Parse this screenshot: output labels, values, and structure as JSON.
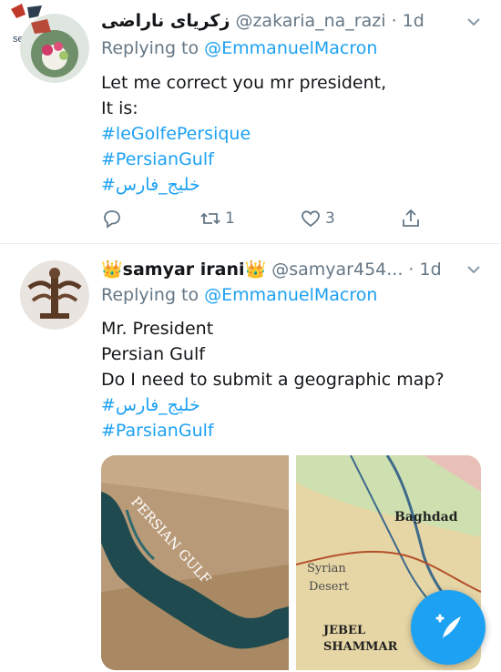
{
  "tweets": [
    {
      "name": "زکریای ناراضی",
      "handle": "@zakaria_na_razi",
      "dot": "·",
      "time": "1d",
      "replying_prefix": "Replying to ",
      "replying_to": "@EmmanuelMacron",
      "lines": [
        "Let me correct you mr president,",
        "It is:"
      ],
      "hashtags": [
        "#leGolfePersique",
        "#PersianGulf",
        "#خلیج_فارس"
      ],
      "actions": {
        "reply_count": "",
        "retweet_count": "1",
        "like_count": "3"
      }
    },
    {
      "name": "👑samyar irani👑",
      "handle": "@samyar454...",
      "dot": "·",
      "time": "1d",
      "replying_prefix": "Replying to ",
      "replying_to": "@EmmanuelMacron",
      "lines": [
        "Mr. President",
        "Persian Gulf",
        "Do I need to submit a geographic map?"
      ],
      "hashtags": [
        "#خلیج_فارس",
        "#ParsianGulf"
      ],
      "media": {
        "left_label": "PERSIAN GULF",
        "right_labels": [
          "Baghdad",
          "Syrian",
          "Desert",
          "JEBEL",
          "SHAMMAR"
        ]
      }
    }
  ],
  "watermark": {
    "text": "seratnews.ir"
  },
  "colors": {
    "accent": "#1da1f2",
    "muted": "#657786",
    "divider": "#e6ecf0"
  },
  "icons": [
    "chevron-down-icon",
    "reply-icon",
    "retweet-icon",
    "like-icon",
    "share-icon",
    "compose-icon"
  ]
}
